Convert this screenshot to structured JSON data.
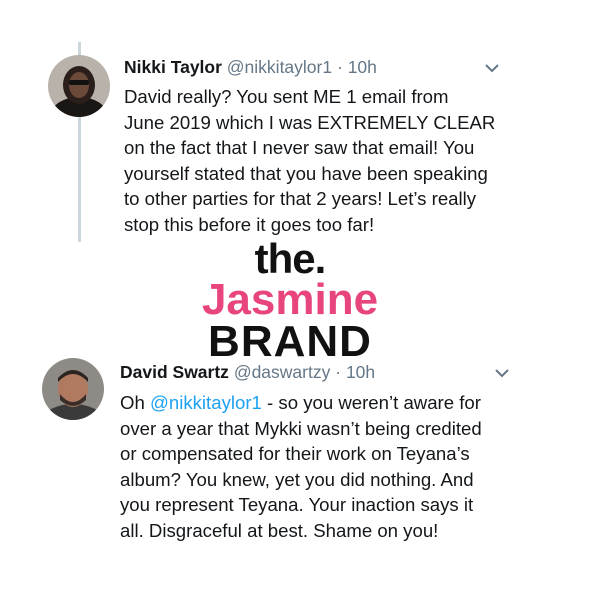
{
  "tweets": [
    {
      "name": "Nikki Taylor",
      "handle": "@nikkitaylor1",
      "separator": "·",
      "time": "10h",
      "lines": [
        "David really? You sent ME 1 email from",
        "June 2019 which I was EXTREMELY CLEAR",
        "on the fact that I never saw that email! You",
        "yourself stated that you have been speaking",
        "to other parties for that 2 years! Let’s really",
        "stop this before it goes too far!"
      ]
    },
    {
      "name": "David Swartz",
      "handle": "@daswartzy",
      "separator": "·",
      "time": "10h",
      "line1_prefix": "Oh ",
      "line1_mention": "@nikkitaylor1",
      "line1_suffix": " - so you weren’t aware for",
      "lines": [
        "over a year that Mykki wasn’t being credited",
        "or compensated for their work on Teyana’s",
        "album? You knew, yet you did nothing. And",
        "you represent Teyana. Your inaction says it",
        "all. Disgraceful at best. Shame on you!"
      ]
    }
  ],
  "watermark": {
    "the": "the.",
    "jasmine": "Jasmine",
    "brand": "BRAND"
  },
  "colors": {
    "mention": "#1da1f2",
    "secondary_text": "#657786",
    "watermark_pink": "#e8447e"
  },
  "icons": [
    "chevron-down-icon",
    "chevron-down-icon"
  ]
}
